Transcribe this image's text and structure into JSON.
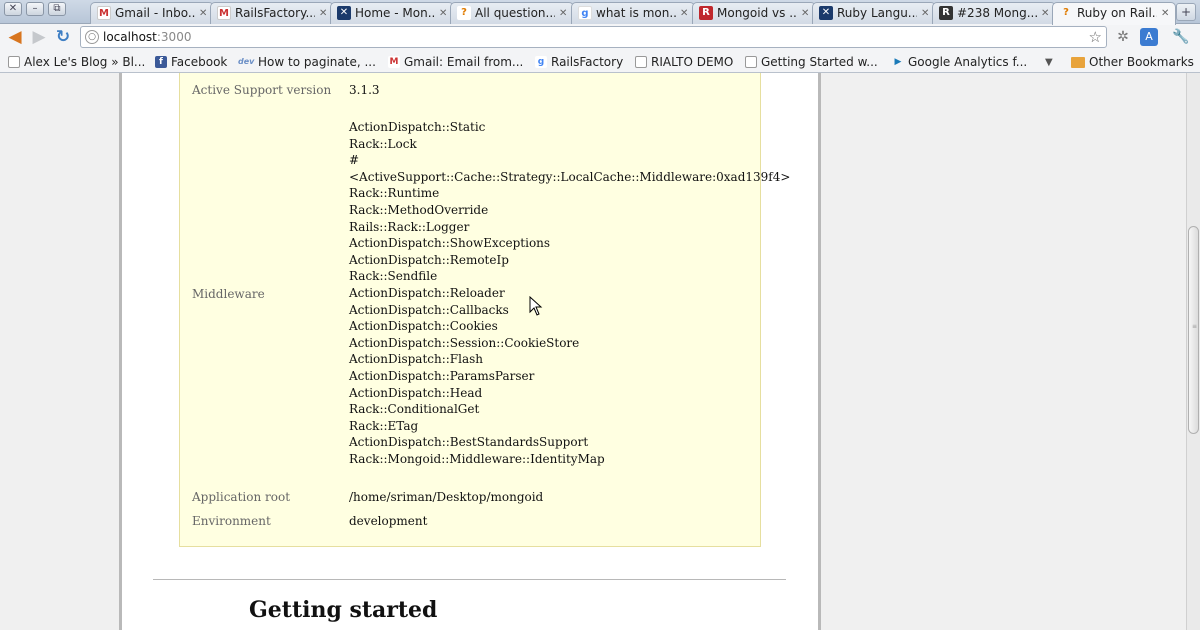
{
  "window_controls": {
    "close": "✕",
    "minimize": "–",
    "maximize": "⧉"
  },
  "tabs": [
    {
      "title": "Gmail - Inbo...",
      "icon": "gmail-icon",
      "active": false
    },
    {
      "title": "RailsFactory...",
      "icon": "gmail-icon",
      "active": false
    },
    {
      "title": "Home - Mon...",
      "icon": "mongoid-x-icon",
      "active": false
    },
    {
      "title": "All question...",
      "icon": "question-icon",
      "active": false
    },
    {
      "title": "what is mon...",
      "icon": "google-icon",
      "active": false
    },
    {
      "title": "Mongoid vs ...",
      "icon": "rf-icon",
      "active": false
    },
    {
      "title": "Ruby Langu...",
      "icon": "mongoid-x-icon",
      "active": false
    },
    {
      "title": "#238 Mong...",
      "icon": "railscasts-icon",
      "active": false
    },
    {
      "title": "Ruby on Rail...",
      "icon": "question-icon",
      "active": true
    }
  ],
  "toolbar": {
    "url_host": "localhost",
    "url_port": ":3000"
  },
  "bookmarks": [
    {
      "label": "Alex Le's Blog » Bl...",
      "icon": "page-icon"
    },
    {
      "label": "Facebook",
      "icon": "facebook-icon"
    },
    {
      "label": "How to paginate, ...",
      "icon": "dev-icon"
    },
    {
      "label": "Gmail: Email from...",
      "icon": "gmail-icon"
    },
    {
      "label": "RailsFactory",
      "icon": "google-icon"
    },
    {
      "label": "RIALTO DEMO",
      "icon": "page-icon"
    },
    {
      "label": "Getting Started w...",
      "icon": "page-icon"
    },
    {
      "label": "Google Analytics f...",
      "icon": "analytics-icon"
    }
  ],
  "bookmarks_overflow": "▼",
  "other_bookmarks": "Other Bookmarks",
  "environment": {
    "active_support_label": "Active Support version",
    "active_support_value": "3.1.3",
    "middleware_label": "Middleware",
    "middleware": [
      "ActionDispatch::Static",
      "Rack::Lock",
      "#",
      "<ActiveSupport::Cache::Strategy::LocalCache::Middleware:0xad139f4>",
      "Rack::Runtime",
      "Rack::MethodOverride",
      "Rails::Rack::Logger",
      "ActionDispatch::ShowExceptions",
      "ActionDispatch::RemoteIp",
      "Rack::Sendfile",
      "ActionDispatch::Reloader",
      "ActionDispatch::Callbacks",
      "ActionDispatch::Cookies",
      "ActionDispatch::Session::CookieStore",
      "ActionDispatch::Flash",
      "ActionDispatch::ParamsParser",
      "ActionDispatch::Head",
      "Rack::ConditionalGet",
      "Rack::ETag",
      "ActionDispatch::BestStandardsSupport",
      "Rack::Mongoid::Middleware::IdentityMap"
    ],
    "app_root_label": "Application root",
    "app_root_value": "/home/sriman/Desktop/mongoid",
    "environment_label": "Environment",
    "environment_value": "development"
  },
  "getting_started": "Getting started"
}
